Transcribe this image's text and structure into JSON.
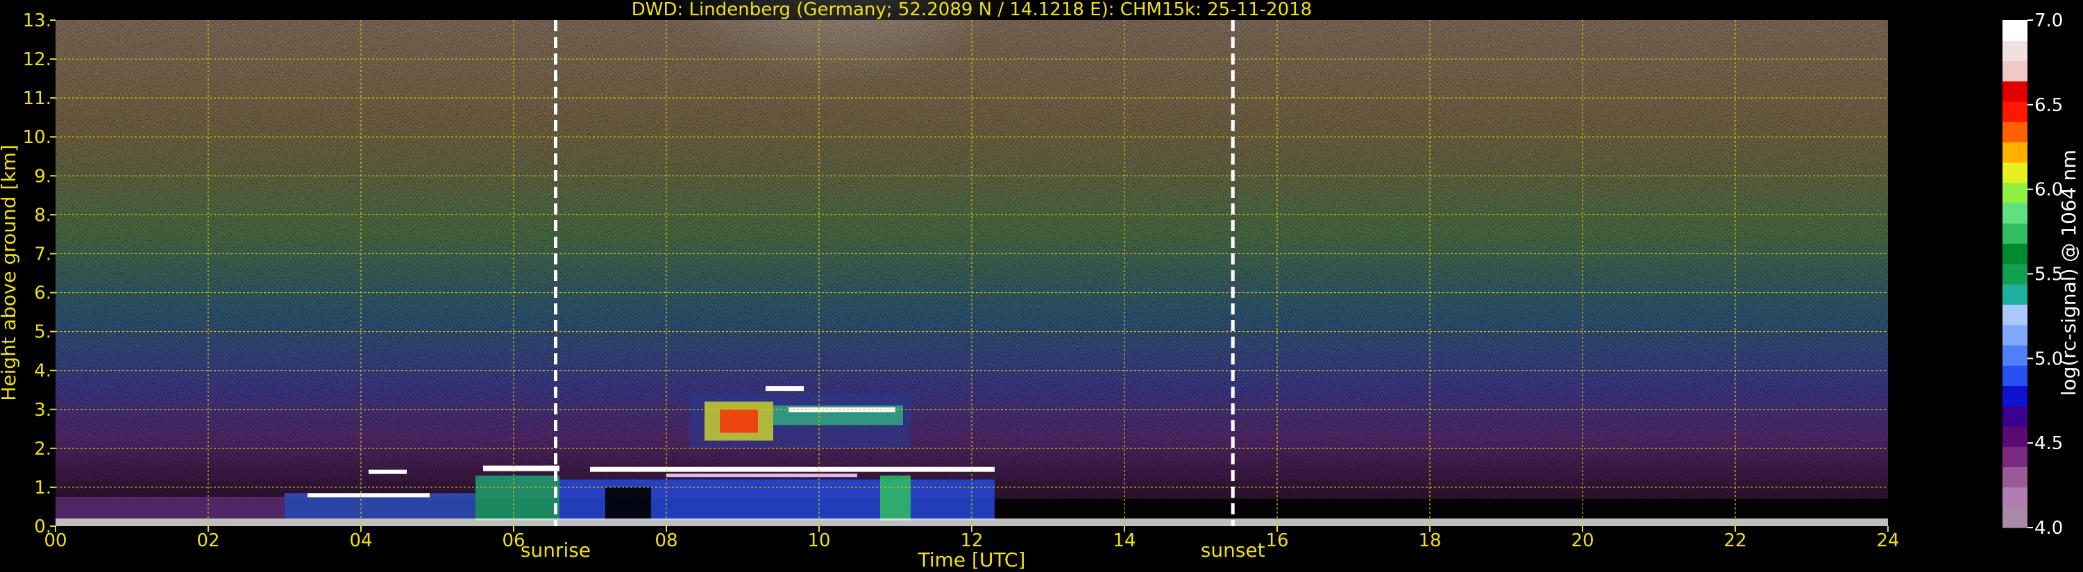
{
  "chart_data": {
    "type": "heatmap",
    "title": "DWD: Lindenberg (Germany; 52.2089 N / 14.1218 E):     CHM15k: 25-11-2018",
    "xlabel": "Time [UTC]",
    "ylabel": "Height above ground [km]",
    "xlim": [
      0,
      24
    ],
    "ylim": [
      0,
      13
    ],
    "x_ticks": [
      "00",
      "02",
      "04",
      "06",
      "08",
      "10",
      "12",
      "14",
      "16",
      "18",
      "20",
      "22",
      "24"
    ],
    "y_ticks": [
      "0.",
      "1.",
      "2.",
      "3.",
      "4.",
      "5.",
      "6.",
      "7.",
      "8.",
      "9.",
      "10.",
      "11.",
      "12.",
      "13."
    ],
    "grid": true,
    "annotations": [
      {
        "label": "sunrise",
        "x": 6.55
      },
      {
        "label": "sunset",
        "x": 15.42
      }
    ],
    "colorbar": {
      "label": "log(rc-signal) @ 1064 nm",
      "range": [
        4.0,
        7.0
      ],
      "ticks": [
        "4.0",
        "4.5",
        "5.0",
        "5.5",
        "6.0",
        "6.5",
        "7.0"
      ],
      "colors": [
        "#a88aa6",
        "#b07db0",
        "#9a5a98",
        "#7a2a80",
        "#5a0a70",
        "#3a0090",
        "#1010d0",
        "#2850f0",
        "#5080f8",
        "#80a8ff",
        "#a8c8ff",
        "#20b0a0",
        "#10a050",
        "#008a30",
        "#30c060",
        "#60e080",
        "#90f040",
        "#e8f020",
        "#ffb000",
        "#ff6000",
        "#ff1800",
        "#e00000",
        "#f0c8c8",
        "#f0e0e0",
        "#ffffff"
      ]
    },
    "features": [
      {
        "type": "cloud_layer",
        "x": [
          6.6,
          12.3
        ],
        "y": 1.45
      },
      {
        "type": "cloud_layer",
        "x": [
          8.3,
          11.2
        ],
        "y": 3.0
      },
      {
        "type": "boundary_layer",
        "x": [
          0,
          12.3
        ],
        "y": [
          0.2,
          1.4
        ]
      },
      {
        "type": "ground_return",
        "x": [
          0,
          24
        ],
        "y": [
          0.05,
          0.25
        ]
      }
    ]
  },
  "colors": {
    "text": "#f0e010",
    "grid": "#d8c800",
    "background": "#000000",
    "colorbar_text": "#ffffff",
    "marker_line": "#ffffff"
  }
}
